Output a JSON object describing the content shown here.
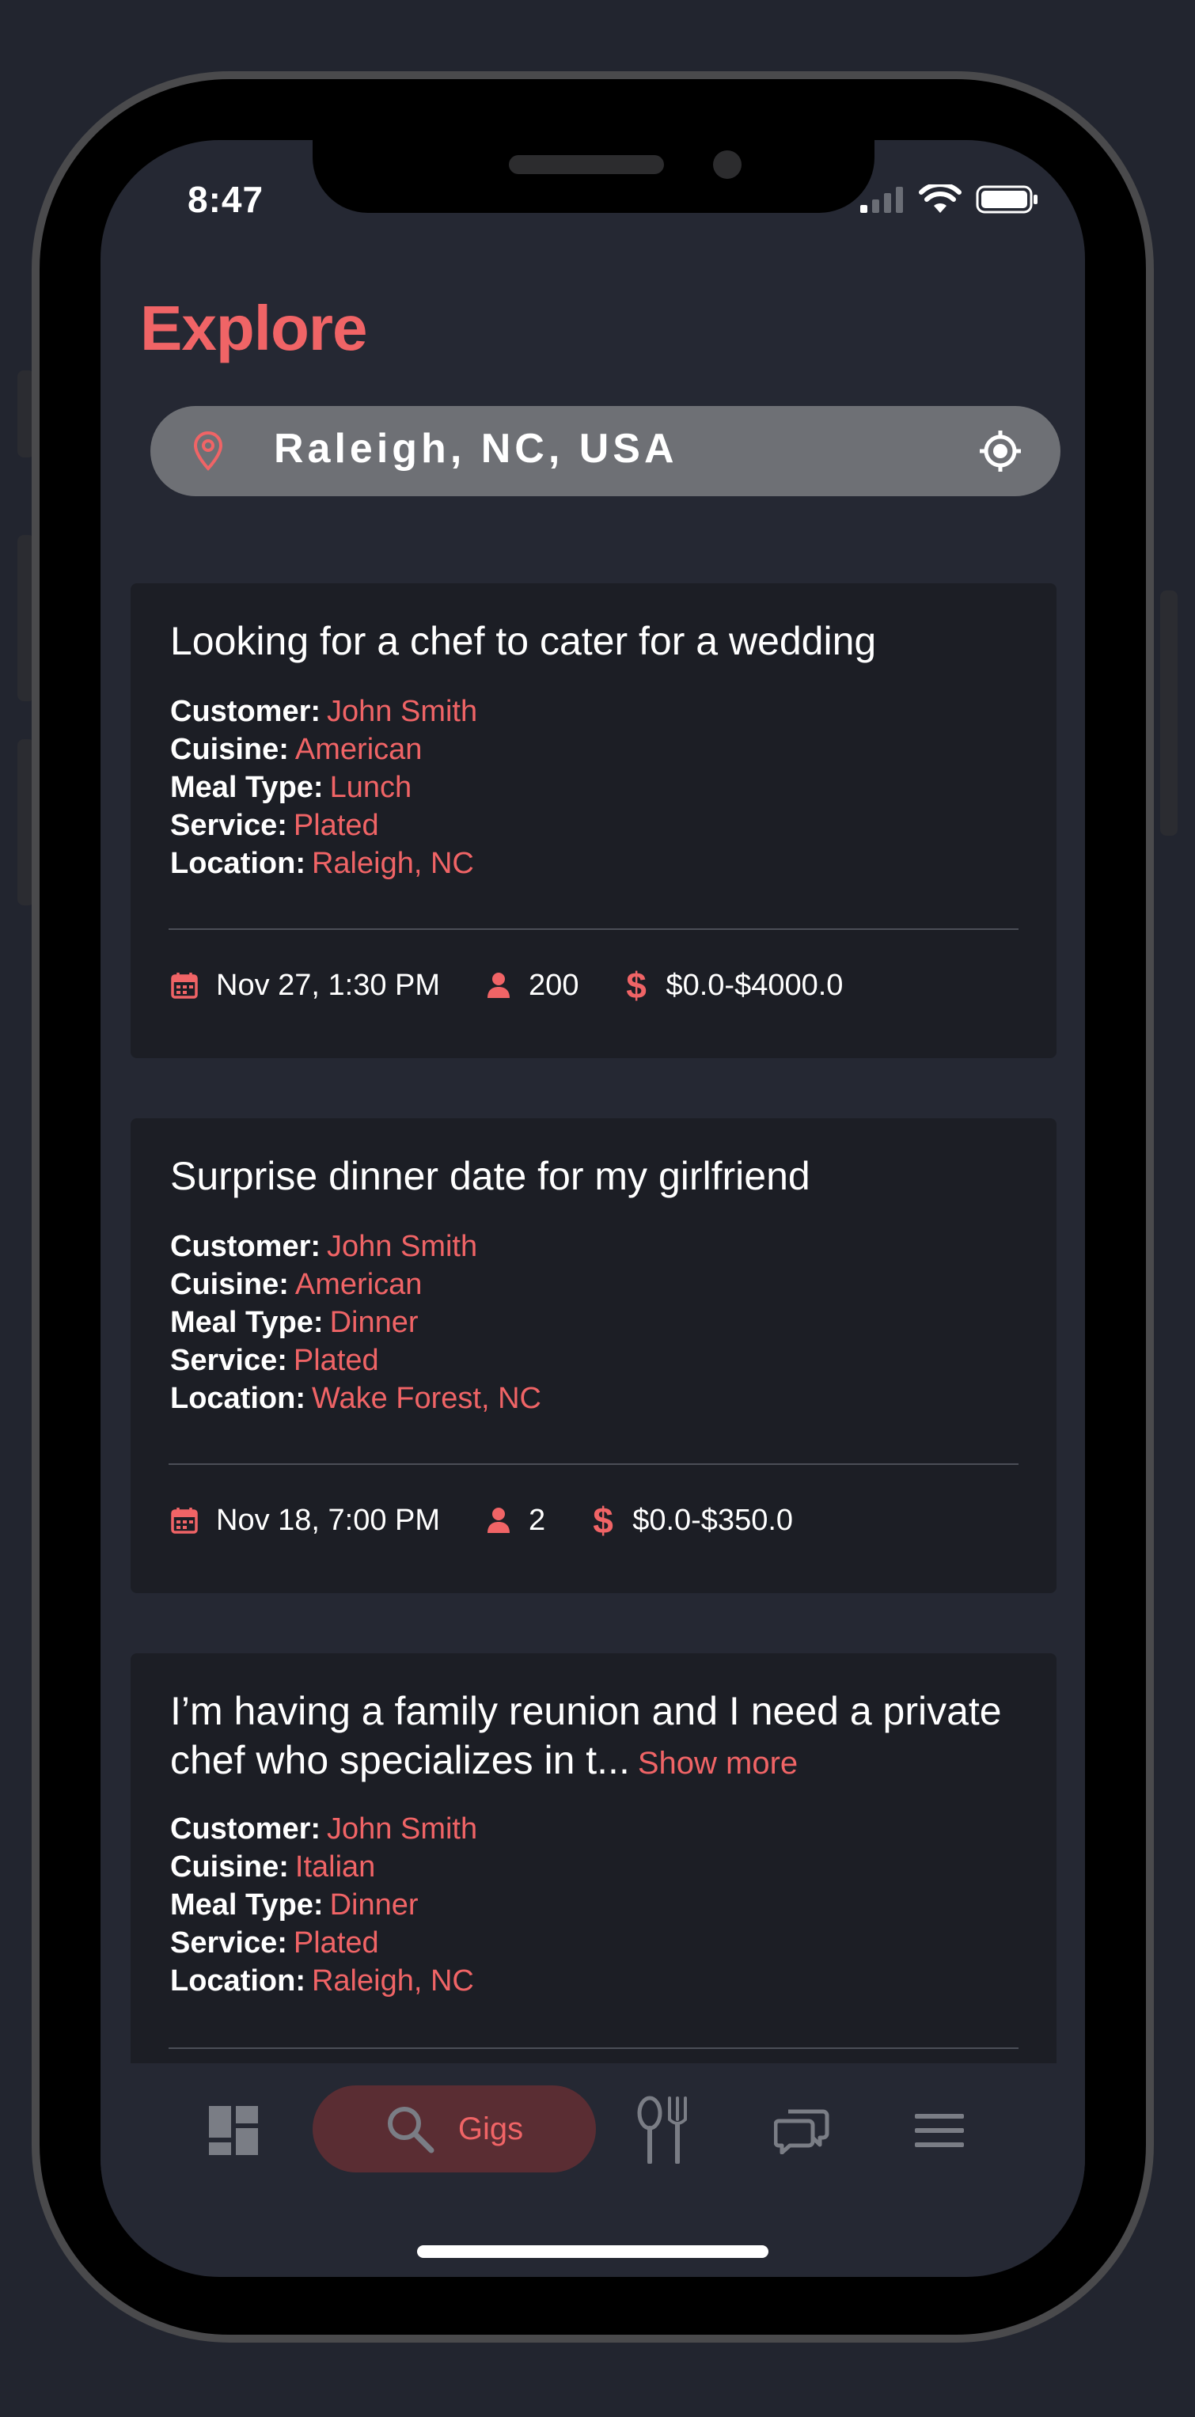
{
  "status_bar": {
    "time": "8:47"
  },
  "header": {
    "title": "Explore"
  },
  "search": {
    "value": "Raleigh, NC, USA",
    "pin_icon": "location-pin-icon",
    "locate_icon": "crosshair-icon"
  },
  "labels": {
    "customer": "Customer:",
    "cuisine": "Cuisine:",
    "meal_type": "Meal Type:",
    "service": "Service:",
    "location": "Location:",
    "show_more": "Show more"
  },
  "gigs": [
    {
      "title": "Looking for a chef to cater for a wedding",
      "customer": "John Smith",
      "cuisine": "American",
      "meal_type": "Lunch",
      "service": "Plated",
      "location": "Raleigh, NC",
      "date": "Nov 27, 1:30 PM",
      "guests": "200",
      "price": "$0.0-$4000.0"
    },
    {
      "title": "Surprise dinner date for my girlfriend",
      "customer": "John Smith",
      "cuisine": "American",
      "meal_type": "Dinner",
      "service": "Plated",
      "location": "Wake Forest, NC",
      "date": "Nov 18, 7:00 PM",
      "guests": "2",
      "price": "$0.0-$350.0"
    },
    {
      "title": "I’m having a family reunion and I need a private chef who specializes in t...",
      "customer": "John Smith",
      "cuisine": "Italian",
      "meal_type": "Dinner",
      "service": "Plated",
      "location": "Raleigh, NC"
    }
  ],
  "bottom_nav": {
    "items": [
      {
        "icon": "dashboard-icon"
      },
      {
        "icon": "search-icon",
        "label": "Gigs",
        "active": true
      },
      {
        "icon": "utensils-icon"
      },
      {
        "icon": "chat-bubbles-icon"
      },
      {
        "icon": "menu-icon"
      }
    ]
  },
  "colors": {
    "accent": "#f06466",
    "background": "#252833",
    "card": "#1c1e25",
    "search_bar": "#6e7075"
  }
}
